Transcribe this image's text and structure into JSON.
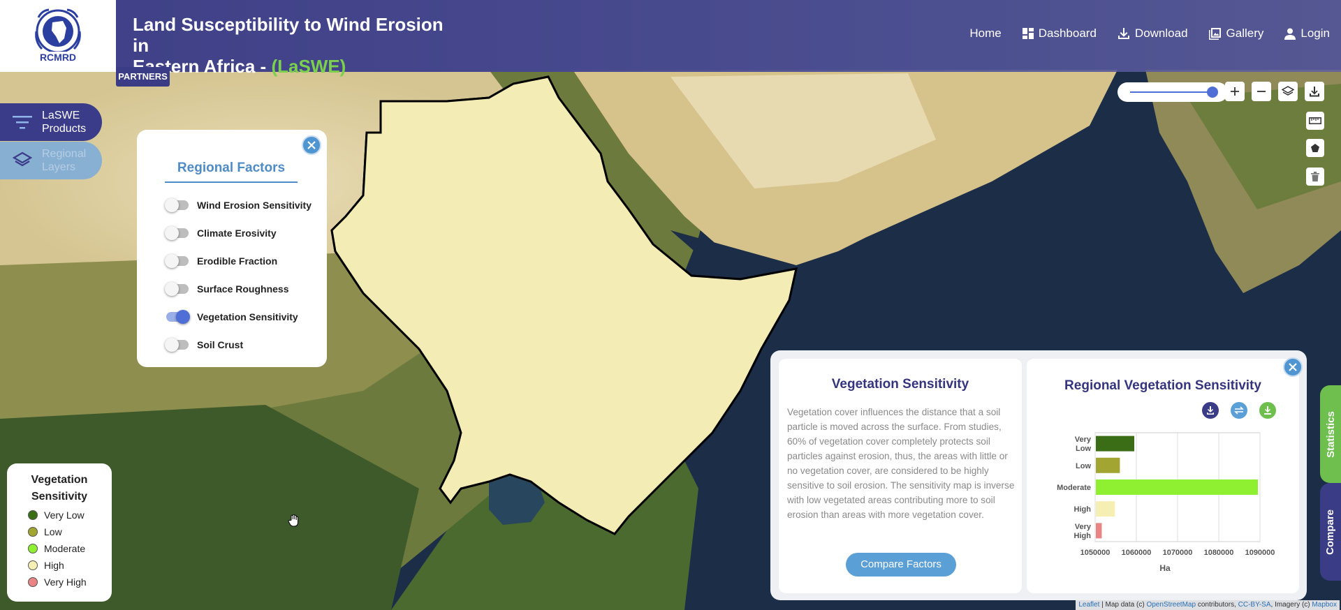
{
  "header": {
    "logo_text": "RCMRD",
    "title_line1": "Land Susceptibility to Wind Erosion in",
    "title_line2": "Eastern Africa - ",
    "title_accent": "(LaSWE)",
    "partners_label": "PARTNERS",
    "nav": {
      "home": "Home",
      "dashboard": "Dashboard",
      "download": "Download",
      "gallery": "Gallery",
      "login": "Login"
    }
  },
  "sidebar": {
    "products_line1": "LaSWE",
    "products_line2": "Products",
    "layers_line1": "Regional",
    "layers_line2": "Layers"
  },
  "factors_panel": {
    "title": "Regional Factors",
    "items": [
      {
        "label": "Wind Erosion Sensitivity",
        "on": false
      },
      {
        "label": "Climate Erosivity",
        "on": false
      },
      {
        "label": "Erodible Fraction",
        "on": false
      },
      {
        "label": "Surface Roughness",
        "on": false
      },
      {
        "label": "Vegetation Sensitivity",
        "on": true
      },
      {
        "label": "Soil Crust",
        "on": false
      }
    ]
  },
  "legend": {
    "title_line1": "Vegetation",
    "title_line2": "Sensitivity",
    "items": [
      {
        "label": "Very Low",
        "color": "#3b6d17"
      },
      {
        "label": "Low",
        "color": "#a2a531"
      },
      {
        "label": "Moderate",
        "color": "#8ff032"
      },
      {
        "label": "High",
        "color": "#f6efb3"
      },
      {
        "label": "Very High",
        "color": "#e98484"
      }
    ]
  },
  "description": {
    "title": "Vegetation Sensitivity",
    "text": "Vegetation cover influences the distance that a soil particle is moved across the surface. From studies, 60% of vegetation cover completely protects soil particles against erosion, thus, the areas with little or no vegetation cover, are considered to be highly sensitive to soil erosion. The sensitivity map is inverse with low vegetated areas contributing more to soil erosion than areas with more vegetation cover.",
    "compare_button": "Compare Factors"
  },
  "chart_data": {
    "type": "bar",
    "orientation": "horizontal",
    "title": "Regional Vegetation Sensitivity",
    "categories": [
      "Very Low",
      "Low",
      "Moderate",
      "High",
      "Very High"
    ],
    "category_lines": [
      [
        "Very",
        "Low"
      ],
      [
        "Low"
      ],
      [
        "Moderate"
      ],
      [
        "High"
      ],
      [
        "Very",
        "High"
      ]
    ],
    "values": [
      1059500,
      1056000,
      1089500,
      1054800,
      1051600
    ],
    "colors": [
      "#3b6d17",
      "#a2a531",
      "#8ff032",
      "#f6efb3",
      "#e98484"
    ],
    "xlabel": "Ha",
    "ylabel": "",
    "xlim": [
      1050000,
      1090000
    ],
    "xticks": [
      1050000,
      1060000,
      1070000,
      1080000,
      1090000
    ],
    "grid": true
  },
  "tabs": {
    "statistics": "Statistics",
    "compare": "Compare"
  },
  "attribution": {
    "leaflet": "Leaflet",
    "sep": " | Map data (c) ",
    "osm": "OpenStreetMap",
    "contrib": " contributors, ",
    "license": "CC-BY-SA",
    "imagery": ", Imagery (c) ",
    "mapbox": "Mapbox"
  }
}
